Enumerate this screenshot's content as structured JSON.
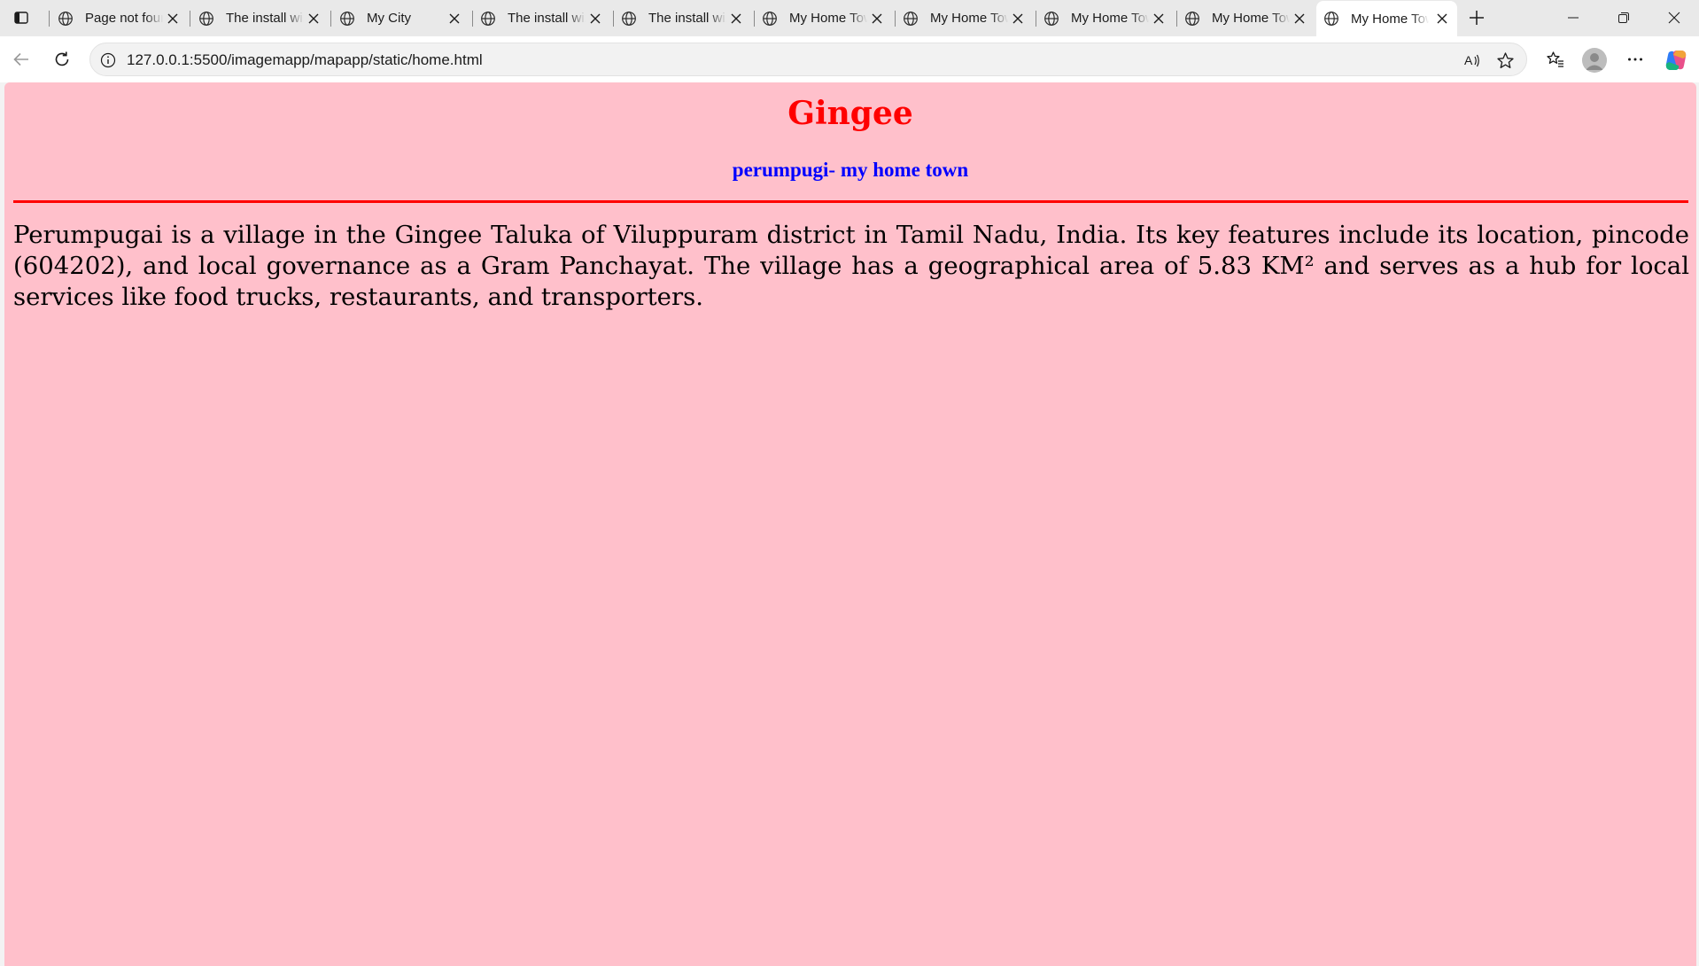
{
  "browser": {
    "tabs": [
      {
        "title": "Page not found",
        "active": false
      },
      {
        "title": "The install wizard",
        "active": false
      },
      {
        "title": "My City",
        "active": false
      },
      {
        "title": "The install wizard",
        "active": false
      },
      {
        "title": "The install wizard",
        "active": false
      },
      {
        "title": "My Home Town",
        "active": false
      },
      {
        "title": "My Home Town",
        "active": false
      },
      {
        "title": "My Home Town",
        "active": false
      },
      {
        "title": "My Home Town",
        "active": false
      },
      {
        "title": "My Home Town",
        "active": true
      }
    ],
    "url": "127.0.0.1:5500/imagemapp/mapapp/static/home.html",
    "icons": {
      "tab_actions": "tab-actions-icon",
      "favicon": "globe-icon",
      "tab_close": "close-icon",
      "new_tab": "plus-icon",
      "minimize": "minimize-icon",
      "restore": "restore-icon",
      "close_window": "close-icon",
      "back": "back-arrow-icon",
      "refresh": "refresh-icon",
      "site_info": "info-icon",
      "read_aloud": "read-aloud-icon",
      "favorite": "star-icon",
      "favorites": "favorites-icon",
      "profile": "avatar-icon",
      "more": "more-icon",
      "copilot": "copilot-icon"
    }
  },
  "page": {
    "title": "Gingee",
    "subtitle": "perumpugi- my home town",
    "body": "Perumpugai is a village in the Gingee Taluka of Viluppuram district in Tamil Nadu, India. Its key features include its location, pincode (604202), and local governance as a Gram Panchayat. The village has a geographical area of 5.83 KM² and serves as a hub for local services like food trucks, restaurants, and transporters.",
    "colors": {
      "background": "#ffc0cb",
      "title": "#ff0000",
      "subtitle": "#0000ff",
      "rule": "#ff0000",
      "body_text": "#000000"
    }
  }
}
